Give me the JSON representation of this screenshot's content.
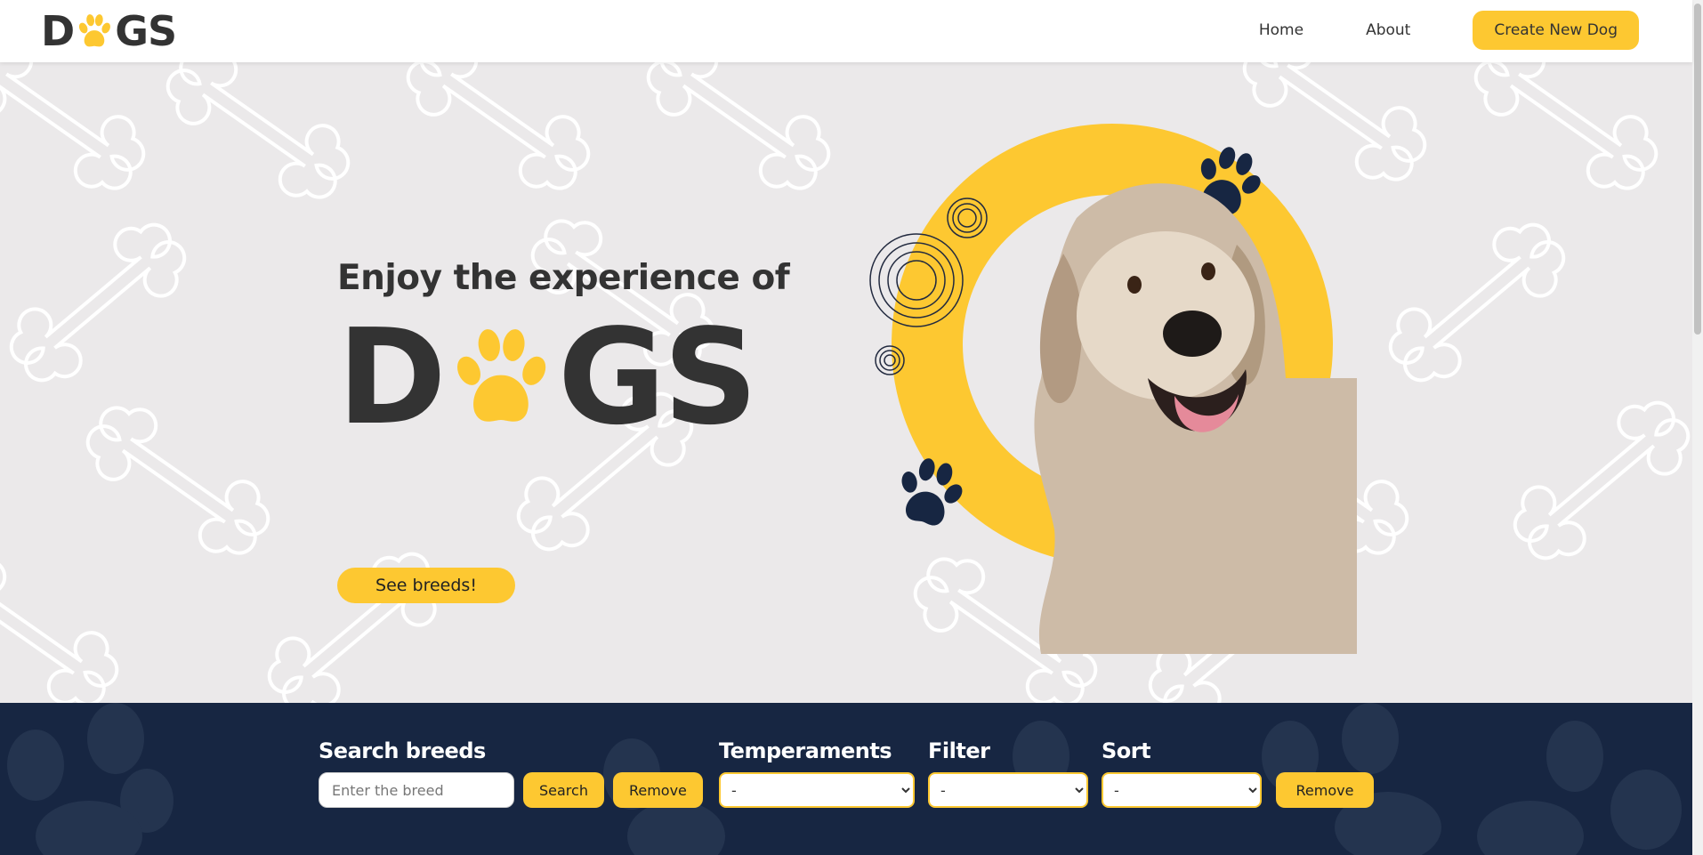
{
  "navbar": {
    "logo": {
      "prefix": "D",
      "suffix": "GS"
    },
    "links": {
      "home": "Home",
      "about": "About"
    },
    "create_button": "Create New Dog"
  },
  "hero": {
    "title": "Enjoy the experience of",
    "logo": {
      "prefix": "D",
      "suffix": "GS"
    },
    "cta_button": "See breeds!"
  },
  "filters": {
    "search": {
      "label": "Search breeds",
      "placeholder": "Enter the breed",
      "search_button": "Search",
      "remove_button": "Remove"
    },
    "temperaments": {
      "label": "Temperaments",
      "selected": "-"
    },
    "filter": {
      "label": "Filter",
      "selected": "-"
    },
    "sort": {
      "label": "Sort",
      "selected": "-"
    },
    "remove_button": "Remove"
  },
  "colors": {
    "accent": "#fdc831",
    "navy": "#172642",
    "hero_bg": "#ebe9ea",
    "text": "#333333"
  },
  "icons": [
    "paw-icon",
    "bone-pattern",
    "concentric-circles-icon",
    "dog-photo"
  ]
}
